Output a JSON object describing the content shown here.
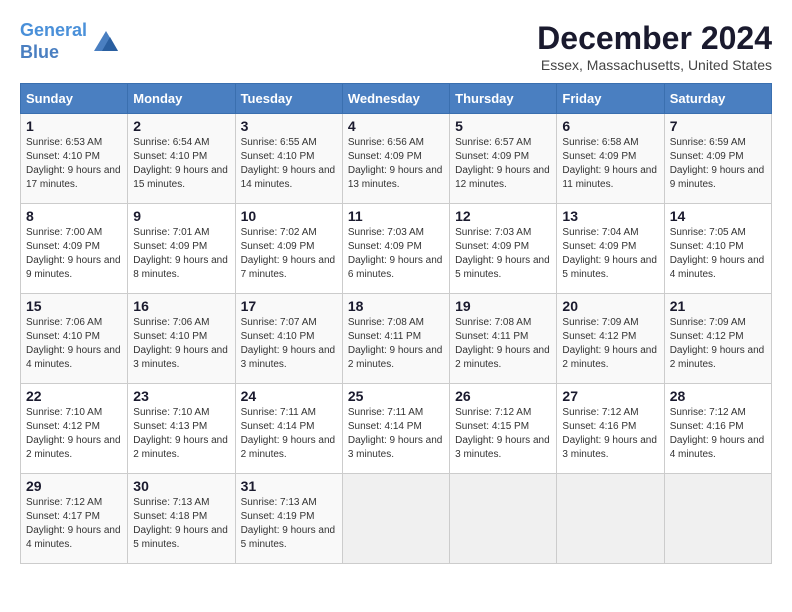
{
  "header": {
    "logo_line1": "General",
    "logo_line2": "Blue",
    "month_title": "December 2024",
    "subtitle": "Essex, Massachusetts, United States"
  },
  "calendar": {
    "days_of_week": [
      "Sunday",
      "Monday",
      "Tuesday",
      "Wednesday",
      "Thursday",
      "Friday",
      "Saturday"
    ],
    "weeks": [
      [
        {
          "day": "1",
          "info": "Sunrise: 6:53 AM\nSunset: 4:10 PM\nDaylight: 9 hours and 17 minutes."
        },
        {
          "day": "2",
          "info": "Sunrise: 6:54 AM\nSunset: 4:10 PM\nDaylight: 9 hours and 15 minutes."
        },
        {
          "day": "3",
          "info": "Sunrise: 6:55 AM\nSunset: 4:10 PM\nDaylight: 9 hours and 14 minutes."
        },
        {
          "day": "4",
          "info": "Sunrise: 6:56 AM\nSunset: 4:09 PM\nDaylight: 9 hours and 13 minutes."
        },
        {
          "day": "5",
          "info": "Sunrise: 6:57 AM\nSunset: 4:09 PM\nDaylight: 9 hours and 12 minutes."
        },
        {
          "day": "6",
          "info": "Sunrise: 6:58 AM\nSunset: 4:09 PM\nDaylight: 9 hours and 11 minutes."
        },
        {
          "day": "7",
          "info": "Sunrise: 6:59 AM\nSunset: 4:09 PM\nDaylight: 9 hours and 9 minutes."
        }
      ],
      [
        {
          "day": "8",
          "info": "Sunrise: 7:00 AM\nSunset: 4:09 PM\nDaylight: 9 hours and 9 minutes."
        },
        {
          "day": "9",
          "info": "Sunrise: 7:01 AM\nSunset: 4:09 PM\nDaylight: 9 hours and 8 minutes."
        },
        {
          "day": "10",
          "info": "Sunrise: 7:02 AM\nSunset: 4:09 PM\nDaylight: 9 hours and 7 minutes."
        },
        {
          "day": "11",
          "info": "Sunrise: 7:03 AM\nSunset: 4:09 PM\nDaylight: 9 hours and 6 minutes."
        },
        {
          "day": "12",
          "info": "Sunrise: 7:03 AM\nSunset: 4:09 PM\nDaylight: 9 hours and 5 minutes."
        },
        {
          "day": "13",
          "info": "Sunrise: 7:04 AM\nSunset: 4:09 PM\nDaylight: 9 hours and 5 minutes."
        },
        {
          "day": "14",
          "info": "Sunrise: 7:05 AM\nSunset: 4:10 PM\nDaylight: 9 hours and 4 minutes."
        }
      ],
      [
        {
          "day": "15",
          "info": "Sunrise: 7:06 AM\nSunset: 4:10 PM\nDaylight: 9 hours and 4 minutes."
        },
        {
          "day": "16",
          "info": "Sunrise: 7:06 AM\nSunset: 4:10 PM\nDaylight: 9 hours and 3 minutes."
        },
        {
          "day": "17",
          "info": "Sunrise: 7:07 AM\nSunset: 4:10 PM\nDaylight: 9 hours and 3 minutes."
        },
        {
          "day": "18",
          "info": "Sunrise: 7:08 AM\nSunset: 4:11 PM\nDaylight: 9 hours and 2 minutes."
        },
        {
          "day": "19",
          "info": "Sunrise: 7:08 AM\nSunset: 4:11 PM\nDaylight: 9 hours and 2 minutes."
        },
        {
          "day": "20",
          "info": "Sunrise: 7:09 AM\nSunset: 4:12 PM\nDaylight: 9 hours and 2 minutes."
        },
        {
          "day": "21",
          "info": "Sunrise: 7:09 AM\nSunset: 4:12 PM\nDaylight: 9 hours and 2 minutes."
        }
      ],
      [
        {
          "day": "22",
          "info": "Sunrise: 7:10 AM\nSunset: 4:12 PM\nDaylight: 9 hours and 2 minutes."
        },
        {
          "day": "23",
          "info": "Sunrise: 7:10 AM\nSunset: 4:13 PM\nDaylight: 9 hours and 2 minutes."
        },
        {
          "day": "24",
          "info": "Sunrise: 7:11 AM\nSunset: 4:14 PM\nDaylight: 9 hours and 2 minutes."
        },
        {
          "day": "25",
          "info": "Sunrise: 7:11 AM\nSunset: 4:14 PM\nDaylight: 9 hours and 3 minutes."
        },
        {
          "day": "26",
          "info": "Sunrise: 7:12 AM\nSunset: 4:15 PM\nDaylight: 9 hours and 3 minutes."
        },
        {
          "day": "27",
          "info": "Sunrise: 7:12 AM\nSunset: 4:16 PM\nDaylight: 9 hours and 3 minutes."
        },
        {
          "day": "28",
          "info": "Sunrise: 7:12 AM\nSunset: 4:16 PM\nDaylight: 9 hours and 4 minutes."
        }
      ],
      [
        {
          "day": "29",
          "info": "Sunrise: 7:12 AM\nSunset: 4:17 PM\nDaylight: 9 hours and 4 minutes."
        },
        {
          "day": "30",
          "info": "Sunrise: 7:13 AM\nSunset: 4:18 PM\nDaylight: 9 hours and 5 minutes."
        },
        {
          "day": "31",
          "info": "Sunrise: 7:13 AM\nSunset: 4:19 PM\nDaylight: 9 hours and 5 minutes."
        },
        null,
        null,
        null,
        null
      ]
    ]
  }
}
